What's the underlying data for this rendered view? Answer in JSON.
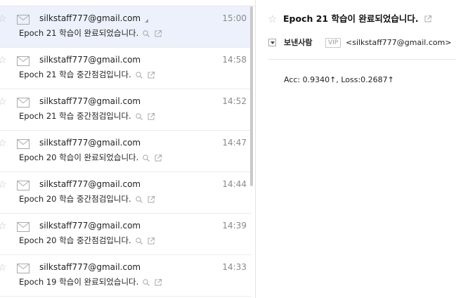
{
  "mail_list": {
    "items": [
      {
        "sender": "silkstaff777@gmail.com",
        "time": "15:00",
        "subject": "Epoch 21 학습이 완료되었습니다.",
        "selected": true
      },
      {
        "sender": "silkstaff777@gmail.com",
        "time": "14:58",
        "subject": "Epoch 21 학습 중간점검입니다.",
        "selected": false
      },
      {
        "sender": "silkstaff777@gmail.com",
        "time": "14:52",
        "subject": "Epoch 21 학습 중간점검입니다.",
        "selected": false
      },
      {
        "sender": "silkstaff777@gmail.com",
        "time": "14:47",
        "subject": "Epoch 20 학습이 완료되었습니다.",
        "selected": false
      },
      {
        "sender": "silkstaff777@gmail.com",
        "time": "14:44",
        "subject": "Epoch 20 학습 중간점검입니다.",
        "selected": false
      },
      {
        "sender": "silkstaff777@gmail.com",
        "time": "14:39",
        "subject": "Epoch 20 학습 중간점검입니다.",
        "selected": false
      },
      {
        "sender": "silkstaff777@gmail.com",
        "time": "14:33",
        "subject": "Epoch 19 학습이 완료되었습니다.",
        "selected": false
      }
    ]
  },
  "reader": {
    "subject": "Epoch 21 학습이 완료되었습니다.",
    "from_label": "보낸사람",
    "vip_label": "VIP",
    "from_email": "<silkstaff777@gmail.com>",
    "body": "Acc: 0.9340↑, Loss:0.2687↑"
  },
  "icons": {
    "star": "star-outline-icon",
    "envelope": "envelope-icon",
    "search": "search-icon",
    "new_window": "new-window-icon",
    "dropdown": "chevron-down-icon"
  },
  "colors": {
    "selected_row": "#ecf1fb",
    "border": "#ececec",
    "time": "#8a8a8a",
    "icon_gray": "#c4c4c4"
  }
}
